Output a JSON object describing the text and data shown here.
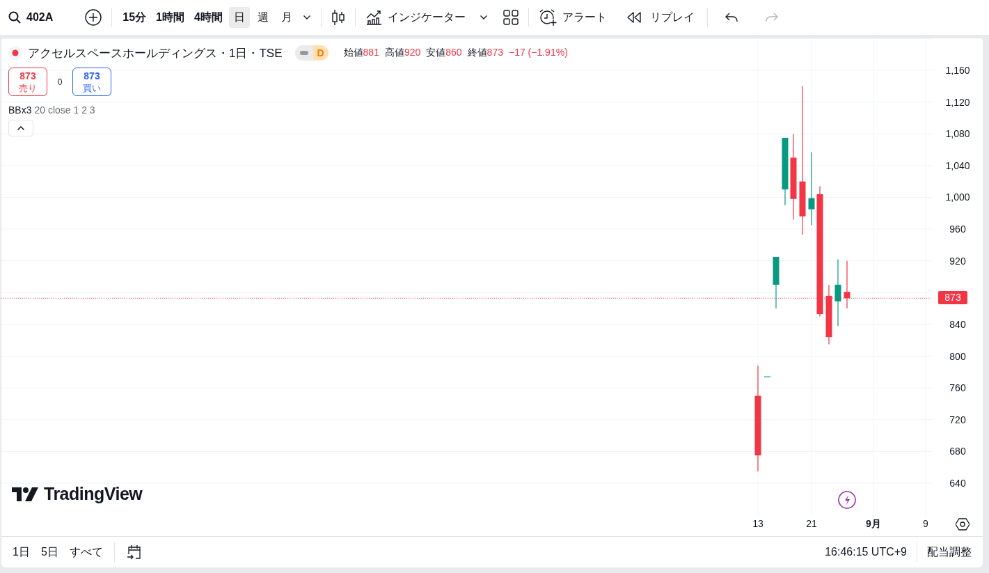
{
  "toolbar": {
    "symbol": "402A",
    "intervals": [
      {
        "label": "15分",
        "selected": false
      },
      {
        "label": "1時間",
        "selected": false
      },
      {
        "label": "4時間",
        "selected": false
      },
      {
        "label": "日",
        "selected": true
      },
      {
        "label": "週",
        "selected": false
      },
      {
        "label": "月",
        "selected": false
      }
    ],
    "indicators_label": "インジケーター",
    "alert_label": "アラート",
    "replay_label": "リプレイ"
  },
  "legend": {
    "title": "アクセルスペースホールディングス・1日・TSE",
    "status_badge": "D",
    "ohlc": [
      {
        "label": "始値",
        "value": "881"
      },
      {
        "label": "高値",
        "value": "920"
      },
      {
        "label": "安値",
        "value": "860"
      },
      {
        "label": "終値",
        "value": "873"
      }
    ],
    "change": "−17 (−1.91%)",
    "sell": {
      "price": "873",
      "label": "売り"
    },
    "spread": "0",
    "buy": {
      "price": "873",
      "label": "買い"
    },
    "indicator": {
      "name": "BBx3",
      "params": "20 close 1 2 3"
    }
  },
  "price_axis": {
    "ticks": [
      "1,160",
      "1,120",
      "1,080",
      "1,040",
      "1,000",
      "960",
      "920",
      "840",
      "800",
      "760",
      "720",
      "680",
      "640"
    ],
    "last_price": "873"
  },
  "time_axis": {
    "ticks": [
      {
        "label": "13",
        "kind": "day"
      },
      {
        "label": "21",
        "kind": "day"
      },
      {
        "label": "9月",
        "kind": "month"
      },
      {
        "label": "9",
        "kind": "day"
      }
    ]
  },
  "logo": "TradingView",
  "bottom_bar": {
    "ranges": [
      "1日",
      "5日",
      "すべて"
    ],
    "clock": "16:46:15 UTC+9",
    "adjust_label": "配当調整"
  }
}
